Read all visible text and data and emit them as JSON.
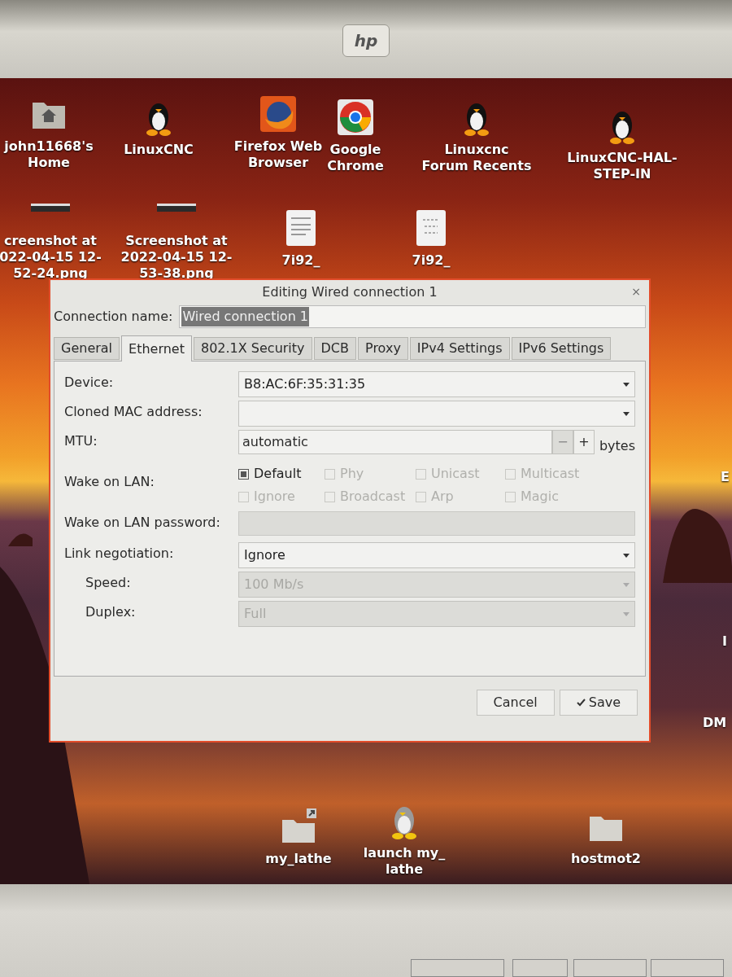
{
  "monitor": {
    "logo": "hp"
  },
  "desktop_icons": [
    {
      "kind": "home",
      "label": "john11668's\nHome"
    },
    {
      "kind": "penguin",
      "label": "LinuxCNC"
    },
    {
      "kind": "firefox",
      "label": "Firefox Web\nBrowser"
    },
    {
      "kind": "chrome",
      "label": "Google\nChrome"
    },
    {
      "kind": "penguin",
      "label": "Linuxcnc\nForum Recents"
    },
    {
      "kind": "penguin",
      "label": "LinuxCNC-HAL-\nSTEP-IN"
    },
    {
      "kind": "screenshot",
      "label": "creenshot at\n022-04-15 12-\n52-24.png"
    },
    {
      "kind": "screenshot",
      "label": "Screenshot at\n2022-04-15 12-\n53-38.png"
    },
    {
      "kind": "textfile",
      "label": "7i92_"
    },
    {
      "kind": "binfile",
      "label": "7i92_"
    },
    {
      "kind": "folder-link",
      "label": "my_lathe"
    },
    {
      "kind": "penguin-gray",
      "label": "launch my_\nlathe"
    },
    {
      "kind": "folder",
      "label": "hostmot2"
    }
  ],
  "edge_labels": [
    "E",
    "I",
    "DM"
  ],
  "dialog": {
    "title": "Editing Wired connection 1",
    "close": "×",
    "connection_name": {
      "label": "Connection name:",
      "value": "Wired connection 1",
      "text_selected": true
    },
    "tabs": [
      {
        "label": "General",
        "selected": false
      },
      {
        "label": "Ethernet",
        "selected": true
      },
      {
        "label": "802.1X Security",
        "selected": false
      },
      {
        "label": "DCB",
        "selected": false
      },
      {
        "label": "Proxy",
        "selected": false
      },
      {
        "label": "IPv4 Settings",
        "selected": false
      },
      {
        "label": "IPv6 Settings",
        "selected": false
      }
    ],
    "device": {
      "label": "Device:",
      "value": "B8:AC:6F:35:31:35"
    },
    "cloned_mac": {
      "label": "Cloned MAC address:"
    },
    "mtu": {
      "label": "MTU:",
      "value": "automatic",
      "minus": "−",
      "plus": "+",
      "unit": "bytes"
    },
    "wake_on_lan": {
      "label": "Wake on LAN:",
      "options": [
        {
          "label": "Default",
          "checked": true,
          "disabled": false
        },
        {
          "label": "Phy",
          "checked": false,
          "disabled": true
        },
        {
          "label": "Unicast",
          "checked": false,
          "disabled": true
        },
        {
          "label": "Multicast",
          "checked": false,
          "disabled": true
        },
        {
          "label": "Ignore",
          "checked": false,
          "disabled": true
        },
        {
          "label": "Broadcast",
          "checked": false,
          "disabled": true
        },
        {
          "label": "Arp",
          "checked": false,
          "disabled": true
        },
        {
          "label": "Magic",
          "checked": false,
          "disabled": true
        }
      ]
    },
    "wol_password": {
      "label": "Wake on LAN password:",
      "disabled": true
    },
    "link_negotiation": {
      "label": "Link negotiation:",
      "value": "Ignore",
      "disabled": false
    },
    "speed": {
      "label": "Speed:",
      "value": "100 Mb/s",
      "disabled": true
    },
    "duplex": {
      "label": "Duplex:",
      "value": "Full",
      "disabled": true
    },
    "buttons": [
      {
        "kind": "cancel",
        "label": "Cancel"
      },
      {
        "kind": "save",
        "label": "Save"
      }
    ]
  }
}
